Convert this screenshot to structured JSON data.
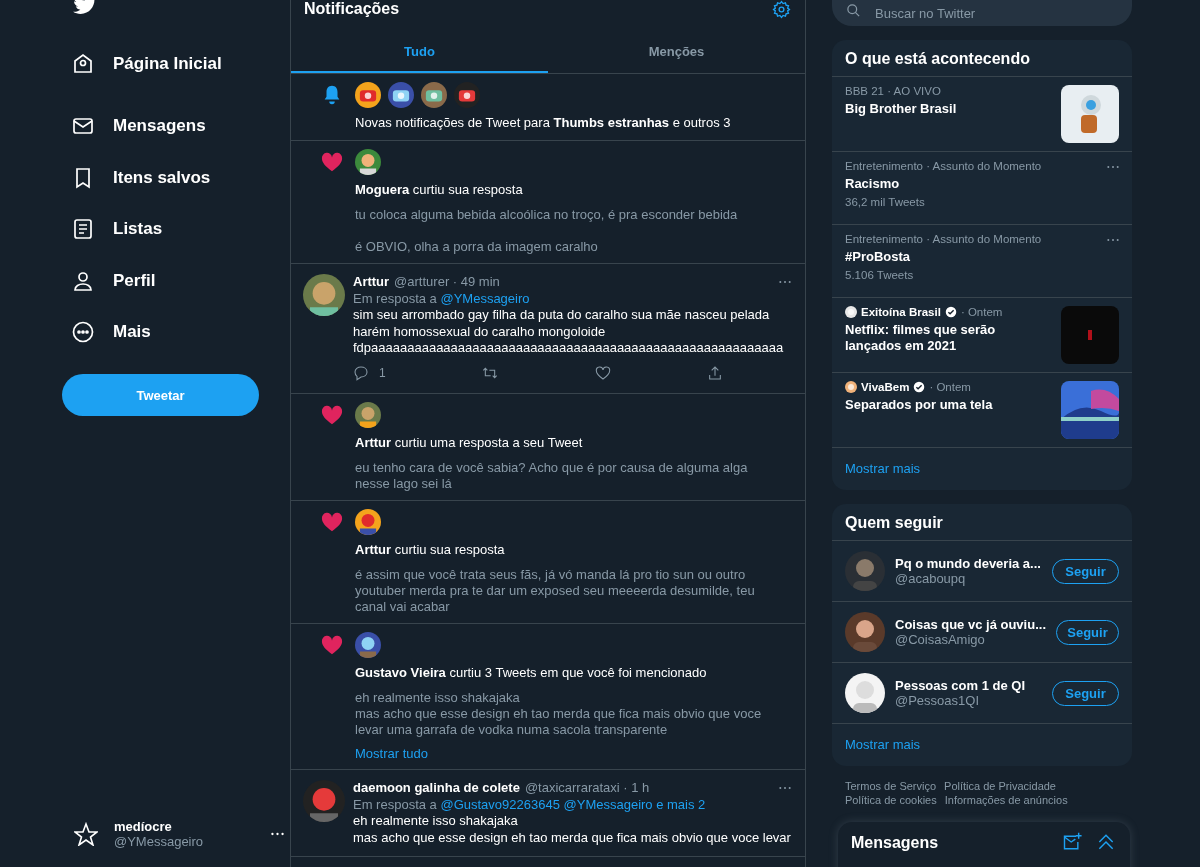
{
  "sidebar": {
    "items": [
      {
        "kind": "home",
        "label": "Página Inicial"
      },
      {
        "kind": "mail",
        "label": "Mensagens"
      },
      {
        "kind": "bookmark",
        "label": "Itens salvos"
      },
      {
        "kind": "list",
        "label": "Listas"
      },
      {
        "kind": "person",
        "label": "Perfil"
      },
      {
        "kind": "more",
        "label": "Mais"
      }
    ],
    "tweet_button": "Tweetar",
    "account": {
      "name": "medíocre",
      "handle": "@YMessageiro"
    }
  },
  "main": {
    "title": "Notificações",
    "tabs": [
      {
        "label": "Tudo",
        "selected": true
      },
      {
        "label": "Menções",
        "selected": false
      }
    ],
    "notifications": [
      {
        "kind": "bell",
        "text": "Novas notificações de Tweet para **Thumbs estranhas** e outros 3"
      },
      {
        "kind": "like",
        "text": "**Moguera** curtiu sua resposta",
        "body": "tu coloca alguma bebida alcoólica no troço, é pra esconder bebida\n\né OBVIO, olha a porra da imagem caralho"
      },
      {
        "kind": "tweet",
        "name": "Arttur",
        "meta": "@artturer · 49 min",
        "reply_label": "Em resposta a",
        "reply_links": "@YMessageiro",
        "body": "sim seu arrombado gay filha da puta do caralho sua mãe nasceu pelada harém homossexual do caralho mongoloide fdpaaaaaaaaaaaaaaaaaaaaaaaaaaaaaaaaaaaaaaaaaaaaaaaaaaaaaaaaa",
        "reply_count": "1"
      },
      {
        "kind": "like",
        "text": "**Arttur** curtiu uma resposta a seu Tweet",
        "body": "eu tenho cara de você sabia? Acho que é por causa de alguma alga nesse lago sei lá"
      },
      {
        "kind": "like",
        "text": "**Arttur** curtiu sua resposta",
        "body": "é assim que você trata seus fãs, já vó manda lá pro tio sun ou outro youtuber merda pra te dar um exposed seu meeeerda desumilde, teu canal vai acabar"
      },
      {
        "kind": "like",
        "text": "**Gustavo Vieira** curtiu 3 Tweets em que você foi mencionado",
        "body": "eh realmente isso shakajaka\nmas acho que esse design eh tao merda que fica mais obvio que voce levar uma garrafa de vodka numa sacola transparente",
        "show_all": "Mostrar tudo"
      },
      {
        "kind": "tweet",
        "name": "daemoon galinha de colete",
        "meta": "@taxicarrarataxi · 1 h",
        "reply_label": "Em resposta a",
        "reply_links": "@Gustavo92263645 @YMessageiro e mais 2",
        "body": "eh realmente isso shakajaka\nmas acho que esse design eh tao merda que fica mais obvio que voce levar"
      }
    ]
  },
  "right": {
    "search": {
      "placeholder": "Buscar no Twitter"
    },
    "trends": {
      "title": "O que está acontecendo",
      "items": [
        {
          "kind": "topic",
          "meta": "BBB 21 · AO VIVO",
          "title": "Big Brother Brasil",
          "thumbnail": true
        },
        {
          "kind": "topic",
          "meta": "Entretenimento · Assunto do Momento",
          "title": "Racismo",
          "count": "36,2 mil Tweets",
          "menu": true
        },
        {
          "kind": "topic",
          "meta": "Entretenimento · Assunto do Momento",
          "title": "#ProBosta",
          "count": "5.106 Tweets",
          "menu": true
        },
        {
          "kind": "news",
          "source": "Exitoína Brasil",
          "verified": true,
          "time": "· Ontem",
          "title": "Netflix: filmes que serão lançados em 2021",
          "thumbnail": true
        },
        {
          "kind": "news",
          "source": "VivaBem",
          "verified": true,
          "time": "· Ontem",
          "title": "Separados por uma tela",
          "thumbnail": true
        }
      ],
      "more": "Mostrar mais"
    },
    "follow": {
      "title": "Quem seguir",
      "items": [
        {
          "name": "Pq o mundo deveria a...",
          "handle": "@acaboupq",
          "button": "Seguir"
        },
        {
          "name": "Coisas que vc já ouviu...",
          "handle": "@CoisasAmigo",
          "button": "Seguir"
        },
        {
          "name": "Pessoas com 1 de QI",
          "handle": "@Pessoas1QI",
          "button": "Seguir"
        }
      ],
      "more": "Mostrar mais"
    },
    "footer": [
      "Termos de Serviço",
      "Política de Privacidade",
      "Política de cookies",
      "Informações de anúncios"
    ],
    "messages_drawer": {
      "title": "Mensagens"
    }
  }
}
